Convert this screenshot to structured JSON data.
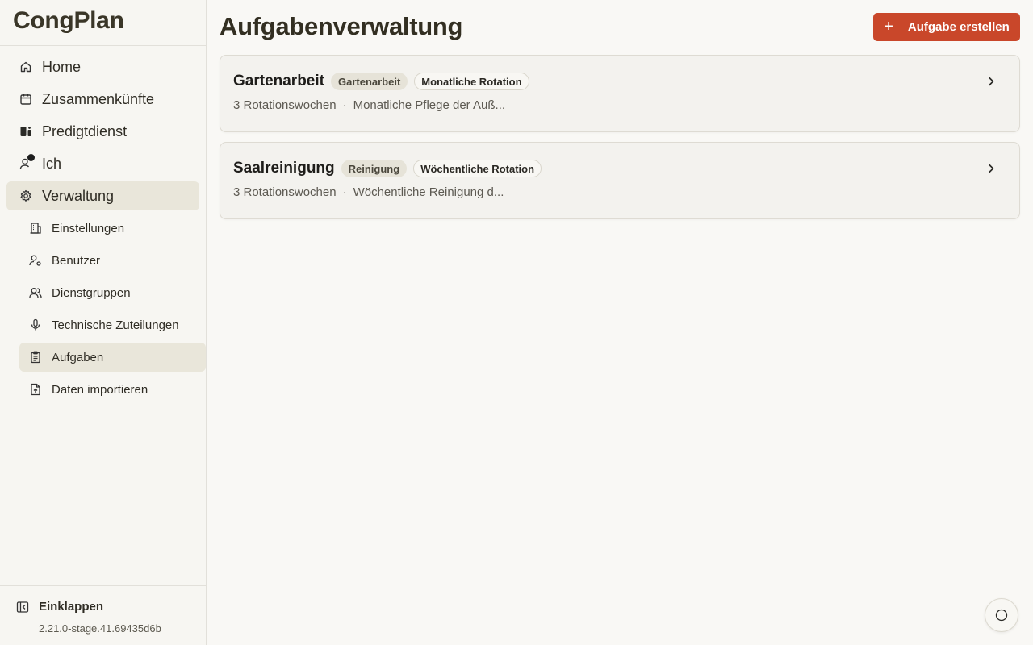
{
  "app": {
    "title": "CongPlan"
  },
  "sidebar": {
    "items": [
      {
        "label": "Home",
        "icon": "home-icon"
      },
      {
        "label": "Zusammenkünfte",
        "icon": "calendar-icon"
      },
      {
        "label": "Predigtdienst",
        "icon": "cart-icon"
      },
      {
        "label": "Ich",
        "icon": "user-icon"
      },
      {
        "label": "Verwaltung",
        "icon": "gear-icon"
      }
    ],
    "subitems": [
      {
        "label": "Einstellungen",
        "icon": "building-icon"
      },
      {
        "label": "Benutzer",
        "icon": "user-cog-icon"
      },
      {
        "label": "Dienstgruppen",
        "icon": "users-icon"
      },
      {
        "label": "Technische Zuteilungen",
        "icon": "microphone-icon"
      },
      {
        "label": "Aufgaben",
        "icon": "clipboard-icon"
      },
      {
        "label": "Daten importieren",
        "icon": "file-upload-icon"
      }
    ],
    "collapse_label": "Einklappen",
    "version": "2.21.0-stage.41.69435d6b"
  },
  "header": {
    "title": "Aufgabenverwaltung",
    "create_button": "Aufgabe erstellen"
  },
  "tasks": [
    {
      "name": "Gartenarbeit",
      "category": "Gartenarbeit",
      "rotation": "Monatliche Rotation",
      "weeks": "3 Rotationswochen",
      "separator": "·",
      "description": "Monatliche Pflege der Auß..."
    },
    {
      "name": "Saalreinigung",
      "category": "Reinigung",
      "rotation": "Wöchentliche Rotation",
      "weeks": "3 Rotationswochen",
      "separator": "·",
      "description": "Wöchentliche Reinigung d..."
    }
  ],
  "colors": {
    "accent": "#c9472a",
    "background": "#f9f8f5",
    "active_nav": "#e9e6da"
  }
}
